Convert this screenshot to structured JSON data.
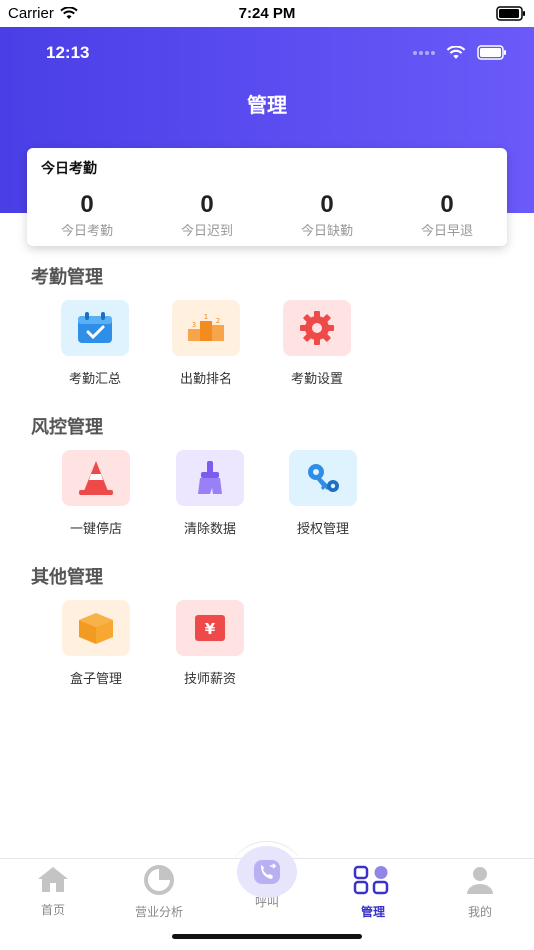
{
  "ios_status": {
    "carrier": "Carrier",
    "time": "7:24 PM"
  },
  "inner_status": {
    "time": "12:13"
  },
  "header": {
    "title": "管理"
  },
  "attendance_card": {
    "title": "今日考勤",
    "stats": [
      {
        "value": "0",
        "label": "今日考勤"
      },
      {
        "value": "0",
        "label": "今日迟到"
      },
      {
        "value": "0",
        "label": "今日缺勤"
      },
      {
        "value": "0",
        "label": "今日早退"
      }
    ]
  },
  "sections": [
    {
      "title": "考勤管理",
      "items": [
        {
          "label": "考勤汇总",
          "icon": "calendar-check-icon"
        },
        {
          "label": "出勤排名",
          "icon": "podium-icon"
        },
        {
          "label": "考勤设置",
          "icon": "gear-icon"
        }
      ]
    },
    {
      "title": "风控管理",
      "items": [
        {
          "label": "一键停店",
          "icon": "traffic-cone-icon"
        },
        {
          "label": "清除数据",
          "icon": "broom-icon"
        },
        {
          "label": "授权管理",
          "icon": "key-gear-icon"
        }
      ]
    },
    {
      "title": "其他管理",
      "items": [
        {
          "label": "盒子管理",
          "icon": "box-icon"
        },
        {
          "label": "技师薪资",
          "icon": "salary-yen-icon"
        }
      ]
    }
  ],
  "tabbar": {
    "tabs": [
      {
        "label": "首页",
        "icon": "home-icon"
      },
      {
        "label": "营业分析",
        "icon": "pie-chart-icon"
      },
      {
        "label": "呼叫",
        "icon": "phone-call-icon"
      },
      {
        "label": "管理",
        "icon": "grid-icon",
        "active": true
      },
      {
        "label": "我的",
        "icon": "user-icon"
      }
    ]
  },
  "colors": {
    "header_start": "#4a3ee6",
    "header_end": "#6a5af9",
    "active_tab": "#3b33c9"
  }
}
